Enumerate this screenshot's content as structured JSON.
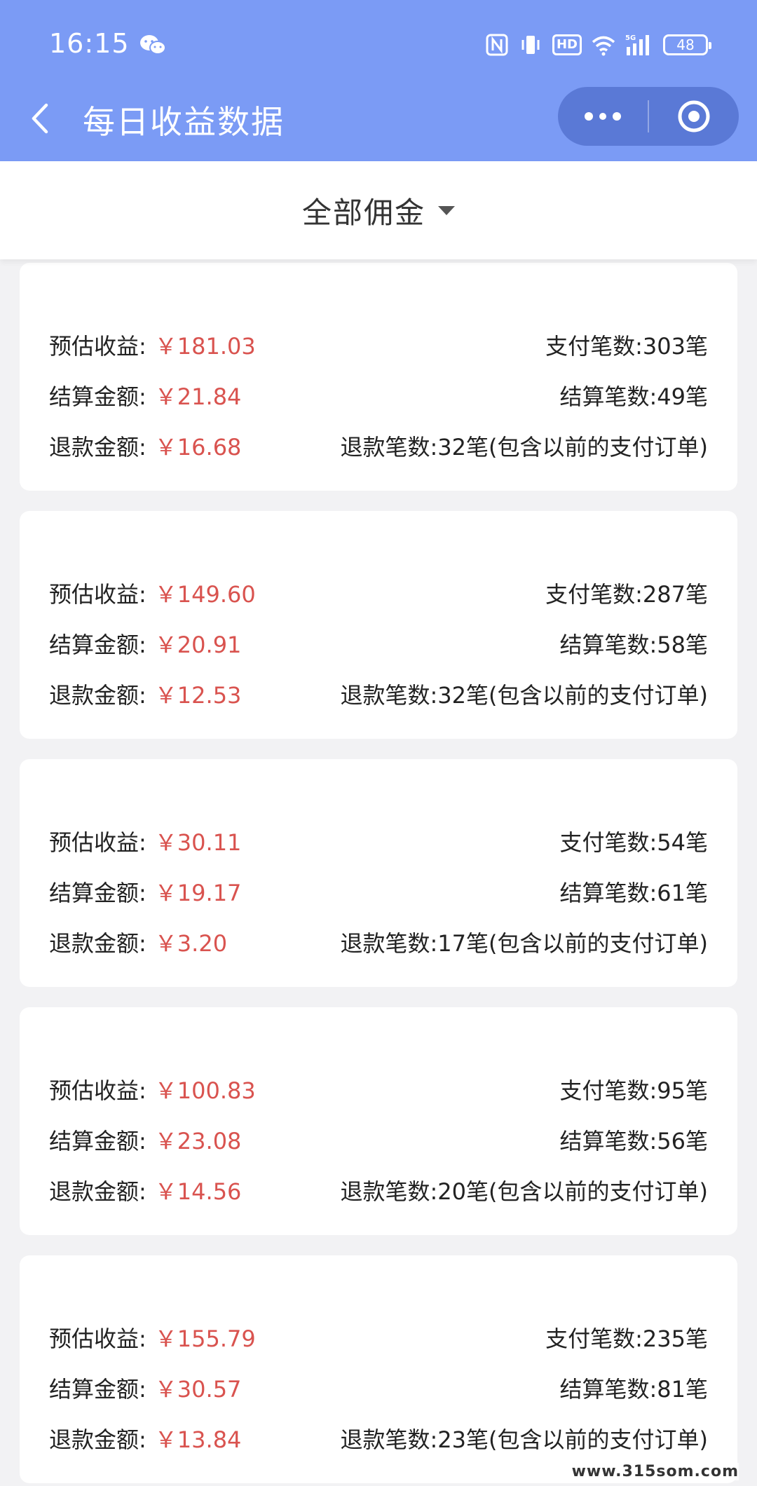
{
  "status_bar": {
    "time": "16:15",
    "hd": "HD",
    "network": "5G",
    "battery": "48"
  },
  "nav": {
    "title": "每日收益数据"
  },
  "filter": {
    "label": "全部佣金"
  },
  "labels": {
    "estimated": "预估收益:",
    "settled": "结算金额:",
    "refund": "退款金额:"
  },
  "cards": [
    {
      "estimated": "￥181.03",
      "settled": "￥21.84",
      "refund": "￥16.68",
      "pay_count": "支付笔数:303笔",
      "settle_count": "结算笔数:49笔",
      "refund_count": "退款笔数:32笔(包含以前的支付订单)"
    },
    {
      "estimated": "￥149.60",
      "settled": "￥20.91",
      "refund": "￥12.53",
      "pay_count": "支付笔数:287笔",
      "settle_count": "结算笔数:58笔",
      "refund_count": "退款笔数:32笔(包含以前的支付订单)"
    },
    {
      "estimated": "￥30.11",
      "settled": "￥19.17",
      "refund": "￥3.20",
      "pay_count": "支付笔数:54笔",
      "settle_count": "结算笔数:61笔",
      "refund_count": "退款笔数:17笔(包含以前的支付订单)"
    },
    {
      "estimated": "￥100.83",
      "settled": "￥23.08",
      "refund": "￥14.56",
      "pay_count": "支付笔数:95笔",
      "settle_count": "结算笔数:56笔",
      "refund_count": "退款笔数:20笔(包含以前的支付订单)"
    },
    {
      "estimated": "￥155.79",
      "settled": "￥30.57",
      "refund": "￥13.84",
      "pay_count": "支付笔数:235笔",
      "settle_count": "结算笔数:81笔",
      "refund_count": "退款笔数:23笔(包含以前的支付订单)"
    }
  ],
  "watermark": "www.315som.com",
  "colors": {
    "header_bg": "#7b9bf5",
    "capsule_bg": "#5a79d6",
    "amount_red": "#d9534f",
    "page_bg": "#f2f2f4"
  }
}
